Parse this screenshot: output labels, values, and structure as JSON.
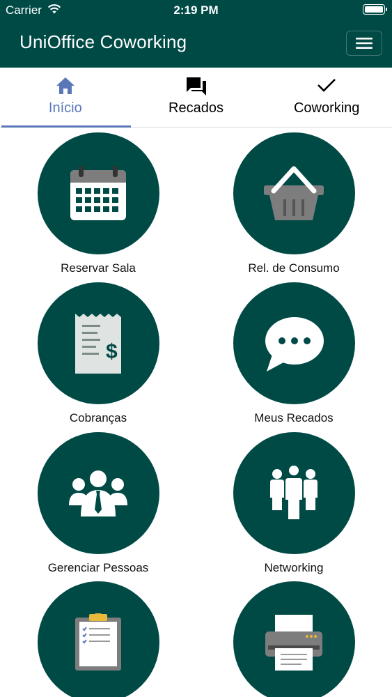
{
  "status_bar": {
    "carrier": "Carrier",
    "time": "2:19 PM"
  },
  "app": {
    "title": "UniOffice Coworking"
  },
  "tabs": [
    {
      "label": "Início",
      "icon": "home-icon",
      "active": true
    },
    {
      "label": "Recados",
      "icon": "chat-icon",
      "active": false
    },
    {
      "label": "Coworking",
      "icon": "check-icon",
      "active": false
    }
  ],
  "menu_items": [
    {
      "label": "Reservar Sala",
      "icon": "calendar-icon"
    },
    {
      "label": "Rel. de Consumo",
      "icon": "basket-icon"
    },
    {
      "label": "Cobranças",
      "icon": "receipt-icon"
    },
    {
      "label": "Meus Recados",
      "icon": "speech-bubble-icon"
    },
    {
      "label": "Gerenciar Pessoas",
      "icon": "people-icon"
    },
    {
      "label": "Networking",
      "icon": "group-icon"
    },
    {
      "label": "",
      "icon": "clipboard-icon"
    },
    {
      "label": "",
      "icon": "printer-icon"
    }
  ],
  "colors": {
    "brand": "#004a46",
    "accent": "#5a78b8"
  }
}
